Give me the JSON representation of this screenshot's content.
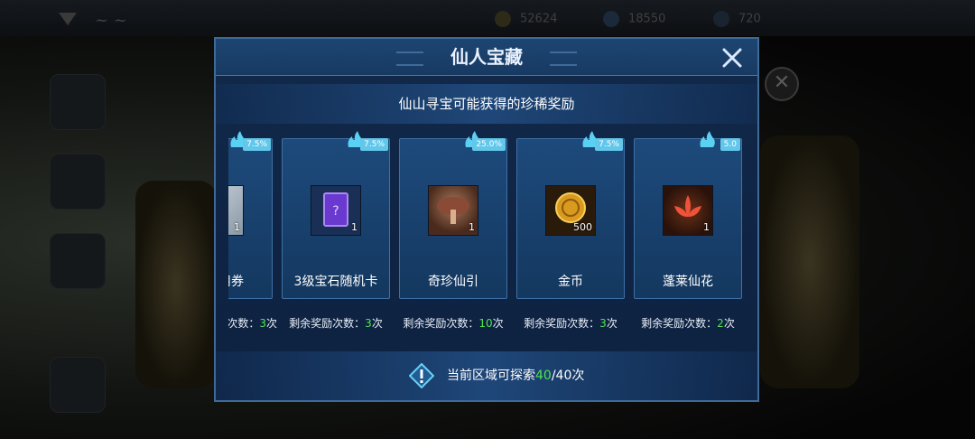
{
  "background": {
    "resources": [
      "52624",
      "18550",
      "720"
    ]
  },
  "dialog": {
    "title": "仙人宝藏",
    "subtitle": "仙山寻宝可能获得的珍稀奖励",
    "close_icon": "close-icon",
    "remain_prefix": "剩余奖励次数：",
    "remain_suffix": "次",
    "cards": [
      {
        "name": "阁抵用券",
        "rate": "7.5%",
        "quantity": "1",
        "remaining": "3",
        "remain_label_visible": "次数：",
        "icon": "ticket-icon"
      },
      {
        "name": "3级宝石随机卡",
        "rate": "7.5%",
        "quantity": "1",
        "remaining": "3",
        "remain_label_visible": "剩余奖励次数：",
        "icon": "gem-card-icon"
      },
      {
        "name": "奇珍仙引",
        "rate": "25.0%",
        "quantity": "1",
        "remaining": "10",
        "remain_label_visible": "剩余奖励次数：",
        "icon": "mushroom-icon"
      },
      {
        "name": "金币",
        "rate": "7.5%",
        "quantity": "500",
        "remaining": "3",
        "remain_label_visible": "剩余奖励次数：",
        "icon": "gold-coin-icon"
      },
      {
        "name": "蓬莱仙花",
        "rate": "5.0",
        "quantity": "1",
        "remaining": "2",
        "remain_label_visible": "剩余奖励次数：",
        "icon": "lotus-flower-icon"
      }
    ],
    "footer": {
      "prefix": "当前区域可探索",
      "current": "40",
      "total": "/40次"
    },
    "colors": {
      "accent_green": "#4fe34f",
      "badge_blue": "#62c7ea",
      "panel_blue": "#1d4a7c"
    }
  }
}
